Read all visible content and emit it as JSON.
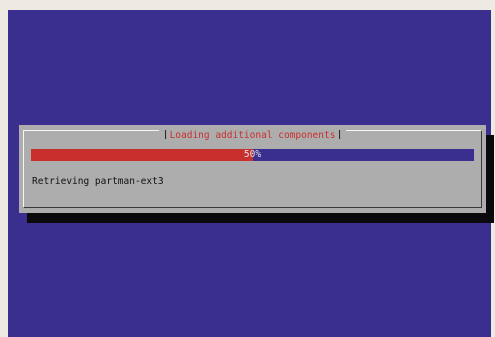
{
  "dialog": {
    "title": "Loading additional components",
    "progress": {
      "label": "50%",
      "percent": 50,
      "fill_color": "#c8302e",
      "track_color": "#3a2e8e"
    },
    "status_text": "Retrieving partman-ext3"
  },
  "colors": {
    "background": "#3a2e8e",
    "dialog": "#adadad",
    "title_text": "#c8302e"
  }
}
